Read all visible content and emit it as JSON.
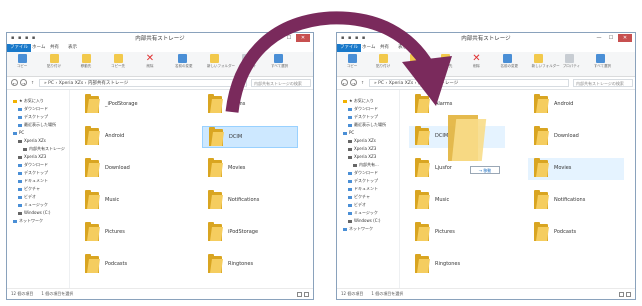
{
  "left": {
    "title": "内部共有ストレージ",
    "quick_access": "▪ ▪ ▪ ▪",
    "tabs": [
      "ファイル",
      "ホーム",
      "共有",
      "表示"
    ],
    "ribbon": [
      {
        "label": "コピー",
        "icon": "copy-icon",
        "color": "blue"
      },
      {
        "label": "貼り付け",
        "icon": "paste-icon",
        "color": "folder"
      },
      {
        "label": "移動先",
        "icon": "move-icon",
        "color": "folder"
      },
      {
        "label": "コピー先",
        "icon": "copy-to-icon",
        "color": "folder"
      },
      {
        "label": "削除",
        "icon": "delete-icon",
        "color": "red"
      },
      {
        "label": "名前の変更",
        "icon": "rename-icon",
        "color": "blue"
      },
      {
        "label": "新しいフォルダー",
        "icon": "new-folder-icon",
        "color": "folder"
      },
      {
        "label": "プロパティ",
        "icon": "properties-icon",
        "color": "gray"
      },
      {
        "label": "すべて選択",
        "icon": "select-all-icon",
        "color": "blue"
      }
    ],
    "back": "←",
    "forward": "→",
    "up": "↑",
    "crumb": "» PC › Xperia XZs › 内部共有ストレージ",
    "search": "内部共有ストレージの検索",
    "nav": [
      {
        "label": "★ お気に入り",
        "color": "#f2b200",
        "indent": 0
      },
      {
        "label": "ダウンロード",
        "color": "#4a8fd6",
        "indent": 1
      },
      {
        "label": "デスクトップ",
        "color": "#4a8fd6",
        "indent": 1
      },
      {
        "label": "最近表示した場所",
        "color": "#4a8fd6",
        "indent": 1
      },
      {
        "label": "PC",
        "color": "#4a8fd6",
        "indent": 0
      },
      {
        "label": "Xperia XZs",
        "color": "#666666",
        "indent": 1
      },
      {
        "label": "内部共有ストレージ",
        "color": "#666666",
        "indent": 2
      },
      {
        "label": "Xperia XZ3",
        "color": "#666666",
        "indent": 1
      },
      {
        "label": "ダウンロード",
        "color": "#4a8fd6",
        "indent": 1
      },
      {
        "label": "デスクトップ",
        "color": "#4a8fd6",
        "indent": 1
      },
      {
        "label": "ドキュメント",
        "color": "#4a8fd6",
        "indent": 1
      },
      {
        "label": "ピクチャ",
        "color": "#4a8fd6",
        "indent": 1
      },
      {
        "label": "ビデオ",
        "color": "#4a8fd6",
        "indent": 1
      },
      {
        "label": "ミュージック",
        "color": "#4a8fd6",
        "indent": 1
      },
      {
        "label": "Windows (C:)",
        "color": "#666666",
        "indent": 1
      },
      {
        "label": "ネットワーク",
        "color": "#4a8fd6",
        "indent": 0
      }
    ],
    "folders_col1": [
      "_iPodStorage",
      "Android",
      "Download",
      "Music",
      "Pictures",
      "Podcasts"
    ],
    "folders_col2": [
      "Alarms",
      "DCIM",
      "Movies",
      "Notifications",
      "iPodStorage",
      "Ringtones"
    ],
    "status": [
      "12 個の項目",
      "1 個の項目を選択"
    ]
  },
  "right": {
    "title": "内部共有ストレージ",
    "quick_access": "▪ ▪ ▪ ▪",
    "tabs": [
      "ファイル",
      "ホーム",
      "共有",
      "表示"
    ],
    "ribbon": [
      {
        "label": "コピー",
        "icon": "copy-icon",
        "color": "blue"
      },
      {
        "label": "貼り付け",
        "icon": "paste-icon",
        "color": "folder"
      },
      {
        "label": "移動先",
        "icon": "move-icon",
        "color": "folder"
      },
      {
        "label": "コピー先",
        "icon": "copy-to-icon",
        "color": "folder"
      },
      {
        "label": "削除",
        "icon": "delete-icon",
        "color": "red"
      },
      {
        "label": "名前の変更",
        "icon": "rename-icon",
        "color": "blue"
      },
      {
        "label": "新しいフォルダー",
        "icon": "new-folder-icon",
        "color": "folder"
      },
      {
        "label": "プロパティ",
        "icon": "properties-icon",
        "color": "gray"
      },
      {
        "label": "すべて選択",
        "icon": "select-all-icon",
        "color": "blue"
      }
    ],
    "back": "←",
    "forward": "→",
    "up": "↑",
    "crumb": "» PC › Xperia XZs › 内部共有ストレージ",
    "search": "内部共有ストレージの検索",
    "nav": [
      {
        "label": "★ お気に入り",
        "color": "#f2b200",
        "indent": 0
      },
      {
        "label": "ダウンロード",
        "color": "#4a8fd6",
        "indent": 1
      },
      {
        "label": "デスクトップ",
        "color": "#4a8fd6",
        "indent": 1
      },
      {
        "label": "最近表示した場所",
        "color": "#4a8fd6",
        "indent": 1
      },
      {
        "label": "PC",
        "color": "#4a8fd6",
        "indent": 0
      },
      {
        "label": "Xperia XZs",
        "color": "#666666",
        "indent": 1
      },
      {
        "label": "Xperia XZ3",
        "color": "#666666",
        "indent": 1
      },
      {
        "label": "Xperia XZ3",
        "color": "#666666",
        "indent": 1
      },
      {
        "label": "内部共有...",
        "color": "#666666",
        "indent": 2
      },
      {
        "label": "ダウンロード",
        "color": "#4a8fd6",
        "indent": 1
      },
      {
        "label": "デスクトップ",
        "color": "#4a8fd6",
        "indent": 1
      },
      {
        "label": "ドキュメント",
        "color": "#4a8fd6",
        "indent": 1
      },
      {
        "label": "ピクチャ",
        "color": "#4a8fd6",
        "indent": 1
      },
      {
        "label": "ビデオ",
        "color": "#4a8fd6",
        "indent": 1
      },
      {
        "label": "ミュージック",
        "color": "#4a8fd6",
        "indent": 1
      },
      {
        "label": "Windows (C:)",
        "color": "#666666",
        "indent": 1
      },
      {
        "label": "ネットワーク",
        "color": "#4a8fd6",
        "indent": 0
      }
    ],
    "folders_col1": [
      "Alarms",
      "DCIM",
      "Ljusfor",
      "Music",
      "Pictures",
      "Ringtones"
    ],
    "folders_col2": [
      "Android",
      "Download",
      "Movies",
      "Notifications",
      "Podcasts"
    ],
    "status": [
      "12 個の項目",
      "1 個の項目を選択"
    ],
    "drag_tip": "→ 移動"
  },
  "arrow_color": "#7a2a5c"
}
